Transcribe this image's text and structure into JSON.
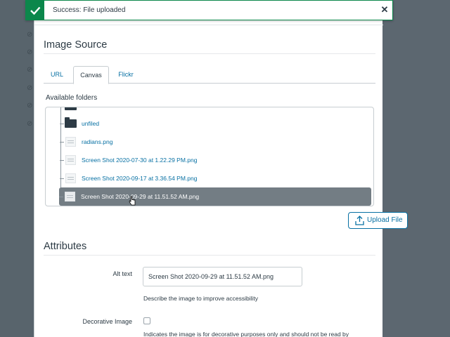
{
  "toast": {
    "message": "Success: File uploaded",
    "close_glyph": "✕",
    "icon": "checkmark-icon",
    "accent": "#0b874b"
  },
  "image_source": {
    "title": "Image Source",
    "tabs": [
      {
        "label": "URL",
        "active": false
      },
      {
        "label": "Canvas",
        "active": true
      },
      {
        "label": "Flickr",
        "active": false
      }
    ],
    "folders_label": "Available folders",
    "items": [
      {
        "label": "unfiled",
        "type": "folder",
        "selected": false
      },
      {
        "label": "radians.png",
        "type": "file",
        "selected": false
      },
      {
        "label": "Screen Shot 2020-07-30 at 1.22.29 PM.png",
        "type": "file",
        "selected": false
      },
      {
        "label": "Screen Shot 2020-09-17 at 3.36.54 PM.png",
        "type": "file",
        "selected": false
      },
      {
        "label": "Screen Shot 2020-09-29 at 11.51.52 AM.png",
        "type": "file",
        "selected": true
      }
    ],
    "upload_button": "Upload File"
  },
  "attributes": {
    "title": "Attributes",
    "alt_text_label": "Alt text",
    "alt_text_value": "Screen Shot 2020-09-29 at 11.51.52 AM.png",
    "alt_text_hint": "Describe the image to improve accessibility",
    "decorative_label": "Decorative Image",
    "decorative_checked": false,
    "decorative_hint": "Indicates the image is for decorative purposes only and should not be read by"
  },
  "colors": {
    "link": "#0770a3",
    "text": "#2d3b45",
    "selected_row": "#737d84"
  }
}
